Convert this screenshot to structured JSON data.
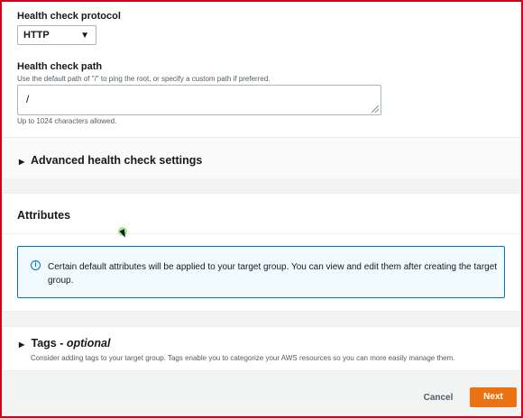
{
  "health_check": {
    "protocol_label": "Health check protocol",
    "protocol_value": "HTTP",
    "path_label": "Health check path",
    "path_description": "Use the default path of \"/\" to ping the root, or specify a custom path if preferred.",
    "path_value": "/",
    "path_hint": "Up to 1024 characters allowed."
  },
  "advanced": {
    "label": "Advanced health check settings"
  },
  "attributes": {
    "title": "Attributes",
    "info_text": "Certain default attributes will be applied to your target group. You can view and edit them after creating the target group."
  },
  "tags": {
    "title": "Tags - ",
    "title_optional": "optional",
    "description": "Consider adding tags to your target group. Tags enable you to categorize your AWS resources so you can more easily manage them."
  },
  "footer": {
    "cancel_label": "Cancel",
    "next_label": "Next"
  },
  "colors": {
    "primary_button": "#ec7211",
    "info_border": "#0073bb",
    "info_background": "#f1faff",
    "frame_border": "#d0021b"
  }
}
